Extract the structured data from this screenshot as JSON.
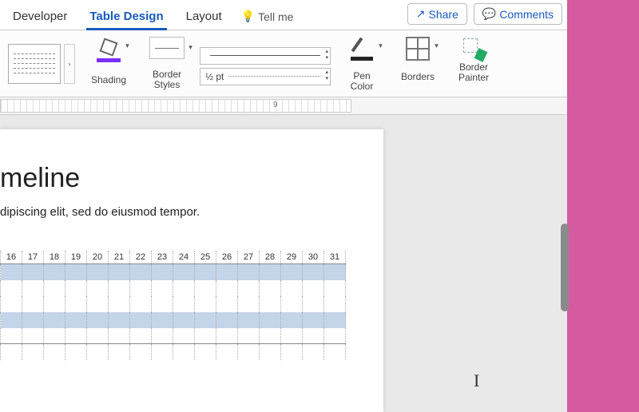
{
  "tabs": {
    "developer": "Developer",
    "table_design": "Table Design",
    "layout": "Layout",
    "tell_me": "Tell me"
  },
  "top_buttons": {
    "share": "Share",
    "comments": "Comments"
  },
  "ribbon": {
    "shading": "Shading",
    "border_styles": "Border\nStyles",
    "weight": "½ pt",
    "pen_color": "Pen\nColor",
    "borders": "Borders",
    "border_painter": "Border\nPainter"
  },
  "ruler": {
    "mark": "9"
  },
  "document": {
    "title_fragment": "meline",
    "body_fragment": "dipiscing elit, sed do eiusmod tempor.",
    "days": [
      "16",
      "17",
      "18",
      "19",
      "20",
      "21",
      "22",
      "23",
      "24",
      "25",
      "26",
      "27",
      "28",
      "29",
      "30",
      "31"
    ]
  }
}
